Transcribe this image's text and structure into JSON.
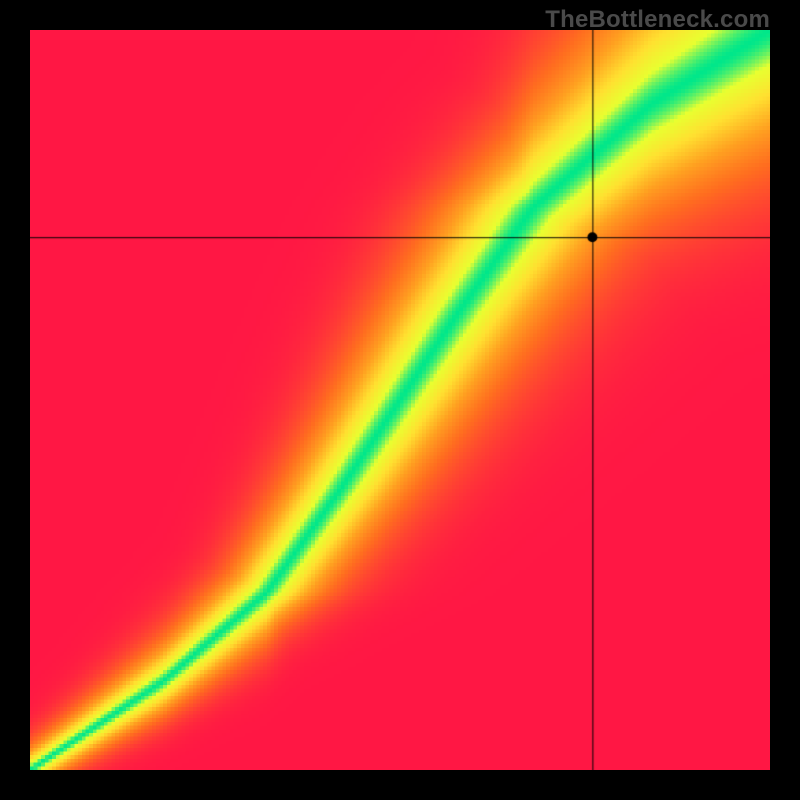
{
  "watermark": "TheBottleneck.com",
  "colors": {
    "frame": "#000000",
    "crosshair": "#000000",
    "point": "#000000",
    "watermark": "#4a4a4a"
  },
  "chart_data": {
    "type": "heatmap",
    "title": "",
    "xlabel": "",
    "ylabel": "",
    "xlim": [
      0,
      100
    ],
    "ylim": [
      0,
      100
    ],
    "grid": false,
    "legend": false,
    "color_scale": [
      {
        "value": 0.0,
        "color": "#ff1744"
      },
      {
        "value": 0.35,
        "color": "#ff6d1f"
      },
      {
        "value": 0.55,
        "color": "#ffa020"
      },
      {
        "value": 0.75,
        "color": "#ffe030"
      },
      {
        "value": 0.9,
        "color": "#e8ff30"
      },
      {
        "value": 1.0,
        "color": "#00e78a"
      }
    ],
    "ridge": {
      "points": [
        {
          "x": 0,
          "y": 0
        },
        {
          "x": 18,
          "y": 12
        },
        {
          "x": 32,
          "y": 24
        },
        {
          "x": 42,
          "y": 38
        },
        {
          "x": 50,
          "y": 50
        },
        {
          "x": 58,
          "y": 62
        },
        {
          "x": 68,
          "y": 76
        },
        {
          "x": 84,
          "y": 90
        },
        {
          "x": 100,
          "y": 100
        }
      ],
      "width_at_bottom": 2.5,
      "width_at_top": 16
    },
    "marker": {
      "x": 76,
      "y": 72,
      "radius": 5
    }
  }
}
